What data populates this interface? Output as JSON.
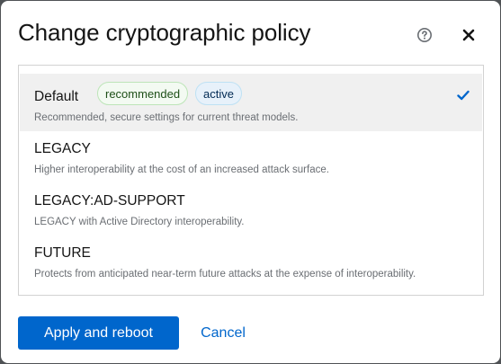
{
  "dialog": {
    "title": "Change cryptographic policy",
    "help_icon": "question-circle-icon",
    "close_icon": "close-icon"
  },
  "policies": [
    {
      "name": "Default",
      "description": "Recommended, secure settings for current threat models.",
      "labels": [
        "recommended",
        "active"
      ],
      "selected": true
    },
    {
      "name": "LEGACY",
      "description": "Higher interoperability at the cost of an increased attack surface."
    },
    {
      "name": "LEGACY:AD-SUPPORT",
      "description": "LEGACY with Active Directory interoperability."
    },
    {
      "name": "FUTURE",
      "description": "Protects from anticipated near-term future attacks at the expense of interoperability."
    }
  ],
  "actions": {
    "apply_label": "Apply and reboot",
    "cancel_label": "Cancel"
  },
  "colors": {
    "primary": "#0066cc",
    "selected_bg": "#f0f0f0",
    "label_green_bg": "#f3faf2",
    "label_blue_bg": "#e7f1fa"
  }
}
